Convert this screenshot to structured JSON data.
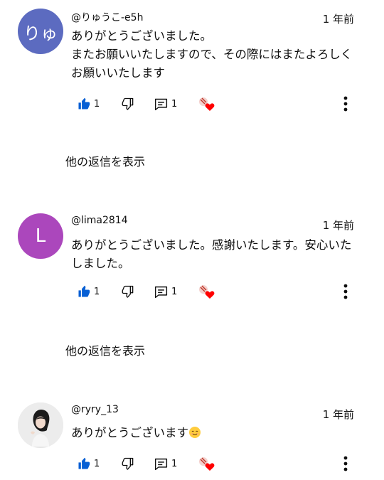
{
  "comments": [
    {
      "handle": "@りゅうこ-e5h",
      "avatar_initial": "りゅ",
      "avatar_color": "#5c6bc0",
      "time": "1 年前",
      "text": "ありがとうございました。\nまたお願いいたしますので、その際にはまたよろしくお願いいたします",
      "like_count": "1",
      "reply_count": "1",
      "show_replies_label": "他の返信を表示"
    },
    {
      "handle": "@lima2814",
      "avatar_initial": "L",
      "avatar_color": "#ab47bc",
      "time": "1 年前",
      "text": "ありがとうございました。感謝いたします。安心いたしました。",
      "like_count": "1",
      "reply_count": "1",
      "show_replies_label": "他の返信を表示"
    },
    {
      "handle": "@ryry_13",
      "avatar_color": "#e6e6e6",
      "time": "1 年前",
      "text": "ありがとうございます",
      "like_count": "1",
      "reply_count": "1"
    }
  ],
  "icons": {
    "like": "thumb-up-filled-icon",
    "dislike": "thumb-down-outline-icon",
    "reply": "comment-icon",
    "creator_heart": "creator-heart-icon",
    "more": "more-vert-icon"
  },
  "colors": {
    "like_blue": "#065fd4",
    "heart_red": "#ff0000"
  }
}
